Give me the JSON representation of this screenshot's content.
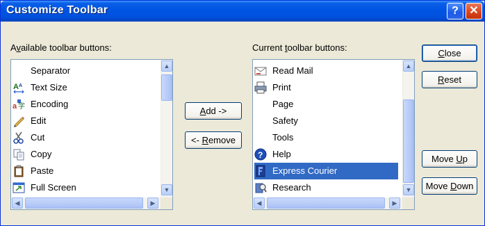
{
  "window": {
    "title": "Customize Toolbar"
  },
  "titlebar_buttons": {
    "help": "?",
    "close": "✕"
  },
  "available": {
    "label": "Available toolbar buttons:",
    "label_pre": "A",
    "label_access": "v",
    "label_post": "ailable toolbar buttons:",
    "items": [
      {
        "label": "Separator",
        "icon": "none"
      },
      {
        "label": "Text Size",
        "icon": "text-size-icon"
      },
      {
        "label": "Encoding",
        "icon": "encoding-icon"
      },
      {
        "label": "Edit",
        "icon": "edit-pencil-icon"
      },
      {
        "label": "Cut",
        "icon": "scissors-icon"
      },
      {
        "label": "Copy",
        "icon": "copy-icon"
      },
      {
        "label": "Paste",
        "icon": "paste-clipboard-icon"
      },
      {
        "label": "Full Screen",
        "icon": "full-screen-icon"
      }
    ]
  },
  "current": {
    "label": "Current toolbar buttons:",
    "label_pre": "Current ",
    "label_access": "t",
    "label_post": "oolbar buttons:",
    "items": [
      {
        "label": "Read Mail",
        "icon": "read-mail-icon"
      },
      {
        "label": "Print",
        "icon": "printer-icon"
      },
      {
        "label": "Page",
        "icon": "none"
      },
      {
        "label": "Safety",
        "icon": "none"
      },
      {
        "label": "Tools",
        "icon": "none"
      },
      {
        "label": "Help",
        "icon": "help-icon"
      },
      {
        "label": "Express Courier",
        "icon": "express-courier-icon",
        "selected": true
      },
      {
        "label": "Research",
        "icon": "research-icon"
      }
    ]
  },
  "buttons": {
    "add": {
      "pre": "",
      "access": "A",
      "post": "dd ->"
    },
    "remove": {
      "pre": "<- ",
      "access": "R",
      "post": "emove"
    },
    "close": {
      "pre": "",
      "access": "C",
      "post": "lose"
    },
    "reset": {
      "pre": "",
      "access": "R",
      "post": "eset"
    },
    "move_up": {
      "pre": "Move ",
      "access": "U",
      "post": "p"
    },
    "move_down": {
      "pre": "Move ",
      "access": "D",
      "post": "own"
    }
  },
  "colors": {
    "title_bar": "#0054e3",
    "selection": "#316ac5",
    "dialog_bg": "#ece9d8",
    "border": "#7f9db9"
  }
}
